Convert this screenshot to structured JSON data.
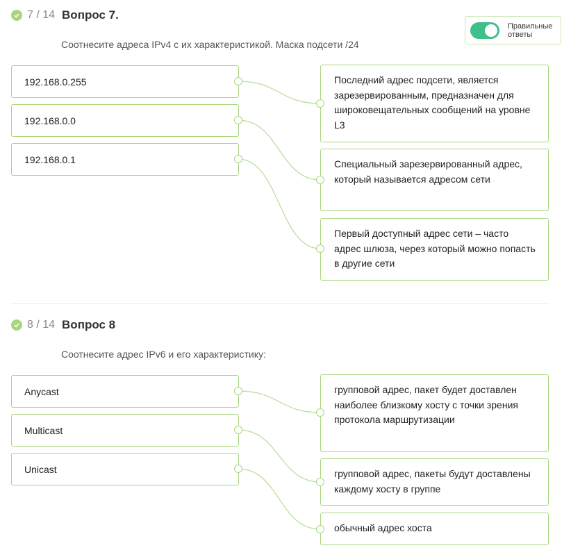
{
  "toggle": {
    "label": "Правильные ответы",
    "on": true
  },
  "q7": {
    "counter": "7 / 14",
    "title": "Вопрос 7.",
    "prompt": "Соотнесите адреса IPv4 с их характеристикой. Маска подсети /24",
    "left": [
      "192.168.0.255",
      "192.168.0.0",
      "192.168.0.1"
    ],
    "right": [
      "Последний адрес подсети, является зарезервированным, предназначен для широковещательных сообщений на уровне L3",
      "Специальный зарезервированный адрес, который называется адресом сети",
      "Первый доступный адрес сети – часто адрес шлюза, через который можно попасть в другие сети"
    ]
  },
  "q8": {
    "counter": "8 / 14",
    "title": "Вопрос 8",
    "prompt": "Соотнесите адрес IPv6 и его характеристику:",
    "left": [
      "Anycast",
      "Multicast",
      "Unicast"
    ],
    "right": [
      "групповой адрес, пакет будет доставлен наиболее близкому хосту с точки зрения протокола маршрутизации",
      "групповой адрес, пакеты будут доставлены каждому хосту в группе",
      "обычный адрес хоста"
    ]
  },
  "colors": {
    "accent": "#a8d67f",
    "toggle": "#3fbf8a"
  }
}
